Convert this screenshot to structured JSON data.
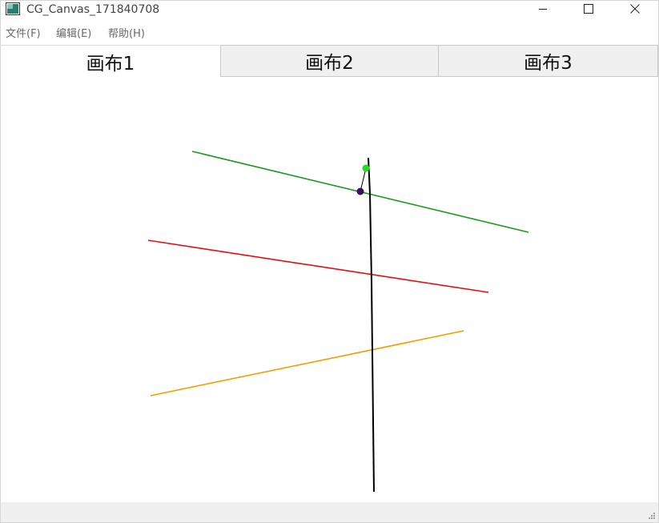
{
  "window": {
    "title": "CG_Canvas_171840708",
    "icon": "app-window-icon"
  },
  "controls": {
    "minimize_icon": "minimize-icon",
    "maximize_icon": "maximize-icon",
    "close_icon": "close-icon"
  },
  "menu": {
    "file": "文件(F)",
    "edit": "编辑(E)",
    "help": "帮助(H)"
  },
  "tabs": [
    {
      "label": "画布1",
      "active": true
    },
    {
      "label": "画布2",
      "active": false
    },
    {
      "label": "画布3",
      "active": false
    }
  ],
  "canvas": {
    "shapes": [
      {
        "name": "green-line",
        "color": "#1a9a1a"
      },
      {
        "name": "red-line",
        "color": "#e01010"
      },
      {
        "name": "orange-line",
        "color": "#f0a000"
      },
      {
        "name": "black-line",
        "color": "#000000"
      },
      {
        "name": "thin-connector-line",
        "color": "#000000"
      },
      {
        "name": "green-control-point",
        "color": "#22dd22"
      },
      {
        "name": "purple-control-point",
        "color": "#3a1060"
      }
    ]
  },
  "statusbar": {
    "grip_icon": "resize-grip-icon"
  }
}
